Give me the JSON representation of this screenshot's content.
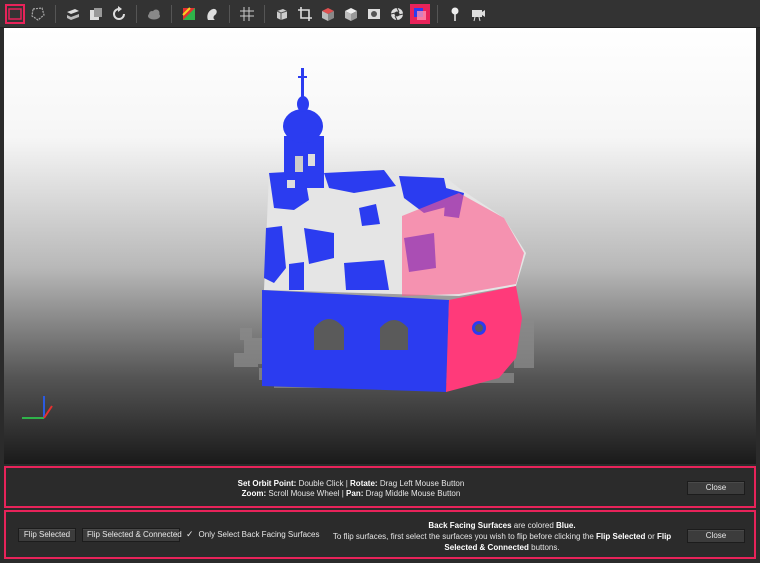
{
  "toolbar": {
    "icons": [
      "rect-select-icon",
      "lasso-select-icon",
      "separator",
      "layers-icon",
      "copy-icon",
      "rotate-icon",
      "separator",
      "cloud-icon",
      "separator",
      "color-icon",
      "squirrel-icon",
      "separator",
      "grid-icon",
      "separator",
      "cube-icon",
      "crop-icon",
      "texture-icon",
      "shade-icon",
      "photo-icon",
      "aperture-icon",
      "flip-normals-icon",
      "separator",
      "pin-icon",
      "camera-icon"
    ],
    "accent_color": "#e8235a"
  },
  "navigation_hint": {
    "orbit_label": "Set Orbit Point:",
    "orbit_value": "Double Click",
    "divider": "|",
    "rotate_label": "Rotate:",
    "rotate_value": "Drag Left Mouse Button",
    "zoom_label": "Zoom:",
    "zoom_value": "Scroll Mouse Wheel",
    "pan_label": "Pan:",
    "pan_value": "Drag Middle Mouse Button",
    "close_label": "Close"
  },
  "flip_panel": {
    "flip_selected_label": "Flip Selected",
    "flip_connected_label": "Flip Selected & Connected",
    "checkmark": "✓",
    "checkbox_label": "Only Select Back Facing Surfaces",
    "info_bold1": "Back Facing Surfaces",
    "info_text1": " are colored ",
    "info_bold2": "Blue.",
    "info_text2": "To flip surfaces, first select the surfaces you wish to flip before clicking the ",
    "info_bold3": "Flip Selected",
    "info_text3": " or ",
    "info_bold4": "Flip Selected & Connected",
    "info_text4": " buttons.",
    "close_label": "Close"
  },
  "colors": {
    "back_facing": "#2b3cf0",
    "selected": "#ff3a7a",
    "background": "#2b2b2b"
  }
}
